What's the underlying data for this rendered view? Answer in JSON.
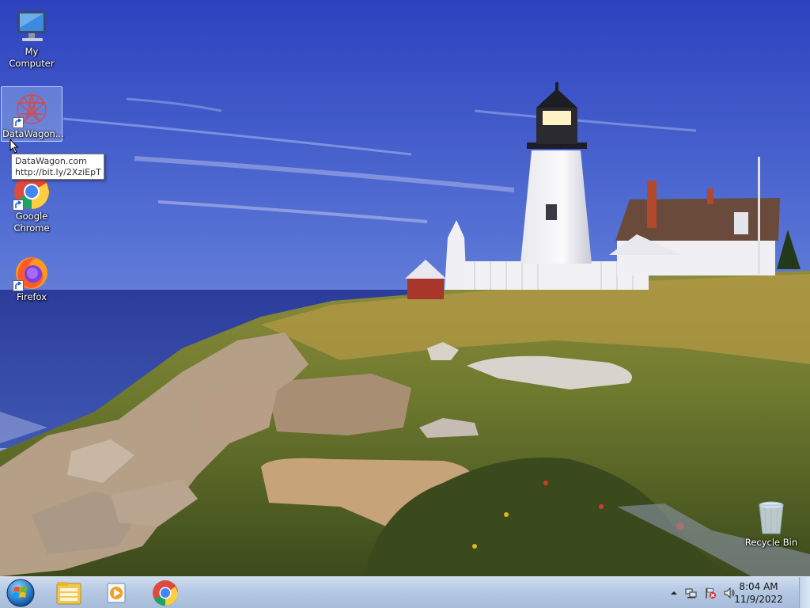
{
  "desktop": {
    "icons": [
      {
        "label": "My Computer"
      },
      {
        "label": "DataWagon..."
      },
      {
        "label": "Google Chrome"
      },
      {
        "label": "Firefox"
      },
      {
        "label": "Recycle Bin"
      }
    ],
    "tooltip": {
      "line1": "DataWagon.com",
      "line2": "http://bit.ly/2XziEpT"
    }
  },
  "taskbar": {
    "start_icon": "windows-start-orb-icon",
    "pinned": [
      {
        "icon": "windows-explorer-icon"
      },
      {
        "icon": "media-player-icon"
      },
      {
        "icon": "google-chrome-icon"
      }
    ],
    "tray": {
      "icons": [
        "show-hidden-icons-chevron",
        "network-icon",
        "action-center-flag-icon",
        "volume-icon"
      ],
      "time": "8:04 AM",
      "date": "11/9/2022"
    }
  },
  "colors": {
    "sky_top": "#2f49c2",
    "sky_bottom": "#8aa6e6",
    "taskbar": "#b5c9e3"
  }
}
